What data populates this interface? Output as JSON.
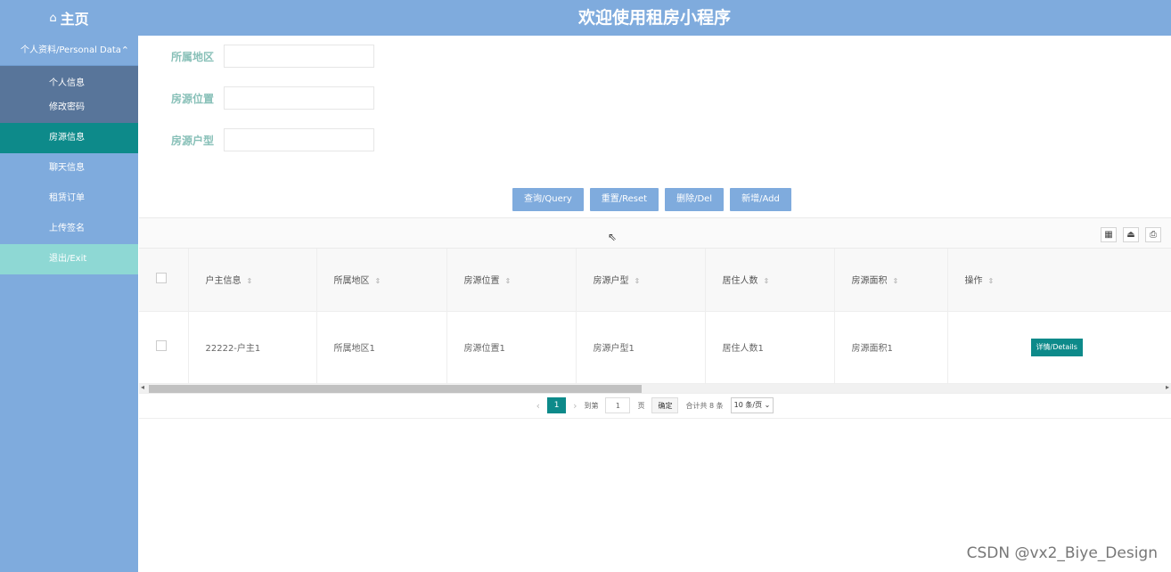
{
  "header": {
    "home_label": "主页",
    "title": "欢迎使用租房小程序"
  },
  "sidebar": {
    "group_label": "个人资料/Personal Data",
    "sub_items": [
      {
        "label": "个人信息"
      },
      {
        "label": "修改密码"
      }
    ],
    "items": [
      {
        "label": "房源信息",
        "active": true
      },
      {
        "label": "聊天信息"
      },
      {
        "label": "租赁订单"
      },
      {
        "label": "上传签名"
      },
      {
        "label": "退出/Exit"
      }
    ]
  },
  "search": {
    "fields": [
      {
        "label": "所属地区",
        "value": ""
      },
      {
        "label": "房源位置",
        "value": ""
      },
      {
        "label": "房源户型",
        "value": ""
      }
    ],
    "buttons": {
      "query": "查询/Query",
      "reset": "重置/Reset",
      "delete": "删除/Del",
      "add": "新增/Add"
    }
  },
  "table": {
    "columns": [
      "户主信息",
      "所属地区",
      "房源位置",
      "房源户型",
      "居住人数",
      "房源面积",
      "操作"
    ],
    "rows": [
      {
        "cells": [
          "22222-户主1",
          "所属地区1",
          "房源位置1",
          "房源户型1",
          "居住人数1",
          "房源面积1"
        ],
        "action": "详情/Details"
      }
    ]
  },
  "pagination": {
    "current_page": "1",
    "goto_label": "到第",
    "goto_value": "1",
    "page_unit": "页",
    "confirm": "确定",
    "total": "合计共 8 条",
    "page_size": "10 条/页"
  },
  "watermark": "CSDN @vx2_Biye_Design"
}
